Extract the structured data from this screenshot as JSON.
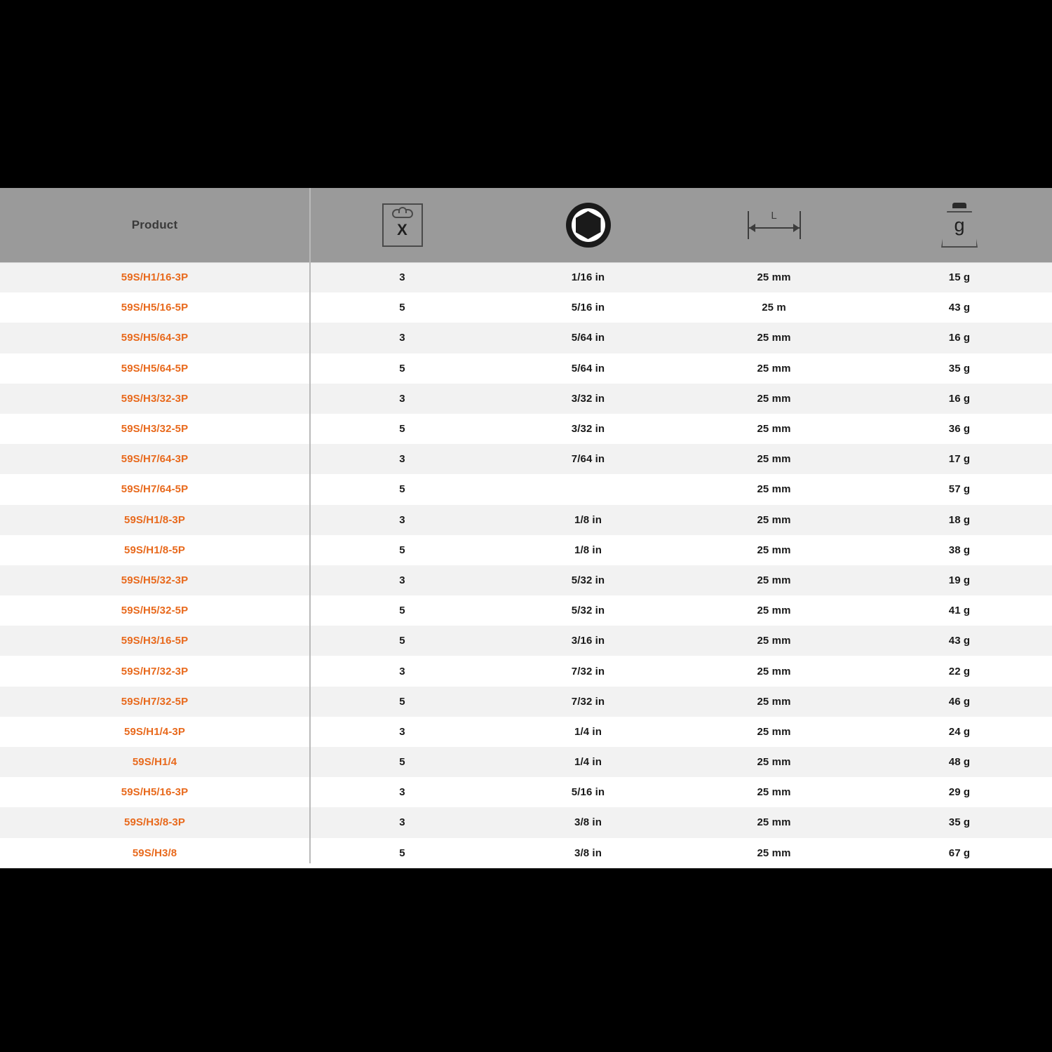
{
  "table": {
    "columns": [
      {
        "key": "product",
        "label": "Product",
        "icon": null
      },
      {
        "key": "pack",
        "label": "",
        "icon": "blister-pack-icon",
        "icon_text": "X"
      },
      {
        "key": "size",
        "label": "",
        "icon": "hex-socket-icon",
        "icon_text": ""
      },
      {
        "key": "length",
        "label": "",
        "icon": "length-dimension-icon",
        "icon_text": "L"
      },
      {
        "key": "weight",
        "label": "",
        "icon": "weight-icon",
        "icon_text": "g"
      }
    ],
    "rows": [
      {
        "product": "59S/H1/16-3P",
        "pack": "3",
        "size": "1/16 in",
        "length": "25 mm",
        "weight": "15 g"
      },
      {
        "product": "59S/H5/16-5P",
        "pack": "5",
        "size": "5/16 in",
        "length": "25 m",
        "weight": "43 g"
      },
      {
        "product": "59S/H5/64-3P",
        "pack": "3",
        "size": "5/64 in",
        "length": "25 mm",
        "weight": "16 g"
      },
      {
        "product": "59S/H5/64-5P",
        "pack": "5",
        "size": "5/64 in",
        "length": "25 mm",
        "weight": "35 g"
      },
      {
        "product": "59S/H3/32-3P",
        "pack": "3",
        "size": "3/32 in",
        "length": "25 mm",
        "weight": "16 g"
      },
      {
        "product": "59S/H3/32-5P",
        "pack": "5",
        "size": "3/32 in",
        "length": "25 mm",
        "weight": "36 g"
      },
      {
        "product": "59S/H7/64-3P",
        "pack": "3",
        "size": "7/64 in",
        "length": "25 mm",
        "weight": "17 g"
      },
      {
        "product": "59S/H7/64-5P",
        "pack": "5",
        "size": "",
        "length": "25 mm",
        "weight": "57 g"
      },
      {
        "product": "59S/H1/8-3P",
        "pack": "3",
        "size": "1/8 in",
        "length": "25 mm",
        "weight": "18 g"
      },
      {
        "product": "59S/H1/8-5P",
        "pack": "5",
        "size": "1/8 in",
        "length": "25 mm",
        "weight": "38 g"
      },
      {
        "product": "59S/H5/32-3P",
        "pack": "3",
        "size": "5/32 in",
        "length": "25 mm",
        "weight": "19 g"
      },
      {
        "product": "59S/H5/32-5P",
        "pack": "5",
        "size": "5/32 in",
        "length": "25 mm",
        "weight": "41 g"
      },
      {
        "product": "59S/H3/16-5P",
        "pack": "5",
        "size": "3/16 in",
        "length": "25 mm",
        "weight": "43 g"
      },
      {
        "product": "59S/H7/32-3P",
        "pack": "3",
        "size": "7/32 in",
        "length": "25 mm",
        "weight": "22 g"
      },
      {
        "product": "59S/H7/32-5P",
        "pack": "5",
        "size": "7/32 in",
        "length": "25 mm",
        "weight": "46 g"
      },
      {
        "product": "59S/H1/4-3P",
        "pack": "3",
        "size": "1/4 in",
        "length": "25 mm",
        "weight": "24 g"
      },
      {
        "product": "59S/H1/4",
        "pack": "5",
        "size": "1/4 in",
        "length": "25 mm",
        "weight": "48 g"
      },
      {
        "product": "59S/H5/16-3P",
        "pack": "3",
        "size": "5/16 in",
        "length": "25 mm",
        "weight": "29 g"
      },
      {
        "product": "59S/H3/8-3P",
        "pack": "3",
        "size": "3/8 in",
        "length": "25 mm",
        "weight": "35 g"
      },
      {
        "product": "59S/H3/8",
        "pack": "5",
        "size": "3/8 in",
        "length": "25 mm",
        "weight": "67 g"
      }
    ]
  },
  "colors": {
    "product_link": "#e8691c",
    "header_bg": "#9a9a9a",
    "row_odd_bg": "#f2f2f2",
    "row_even_bg": "#ffffff",
    "page_bg": "#000000",
    "text": "#1a1a1a"
  }
}
